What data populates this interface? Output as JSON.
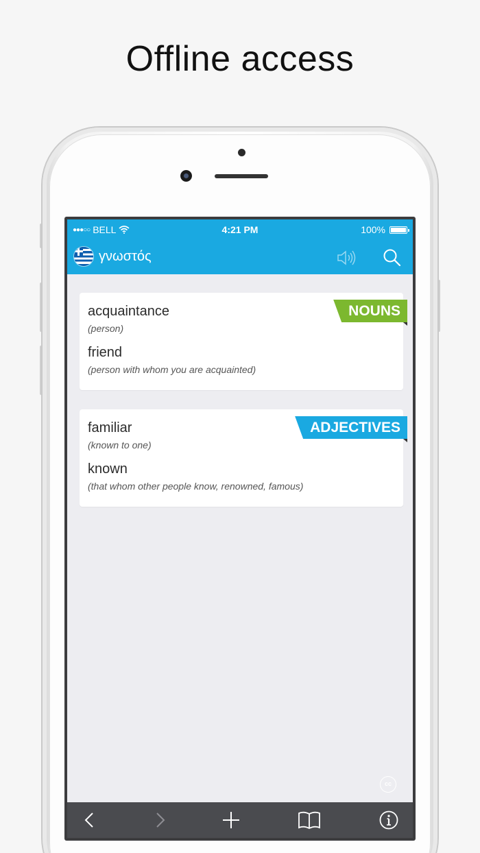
{
  "headline": "Offline access",
  "status_bar": {
    "signal": "●●●○○",
    "carrier": "BELL",
    "time": "4:21 PM",
    "battery": "100%",
    "battery_level": 1.0
  },
  "nav": {
    "title": "γνωστός",
    "flag": "greece-flag-icon"
  },
  "sections": [
    {
      "tag": "NOUNS",
      "color": "#7cb82f",
      "entries": [
        {
          "word": "acquaintance",
          "gloss": "(person)"
        },
        {
          "word": "friend",
          "gloss": "(person with whom you are acquainted)"
        }
      ]
    },
    {
      "tag": "ADJECTIVES",
      "color": "#1aa9e1",
      "entries": [
        {
          "word": "familiar",
          "gloss": "(known to one)"
        },
        {
          "word": "known",
          "gloss": "(that whom other people know, renowned, famous)"
        }
      ]
    }
  ],
  "cc_label": "cc",
  "toolbar": {
    "icons": [
      "back-icon",
      "forward-icon",
      "add-icon",
      "bookmarks-icon",
      "info-icon"
    ]
  },
  "colors": {
    "accent": "#1aa9e1",
    "nouns": "#7cb82f",
    "toolbar": "#4a4b4f"
  }
}
